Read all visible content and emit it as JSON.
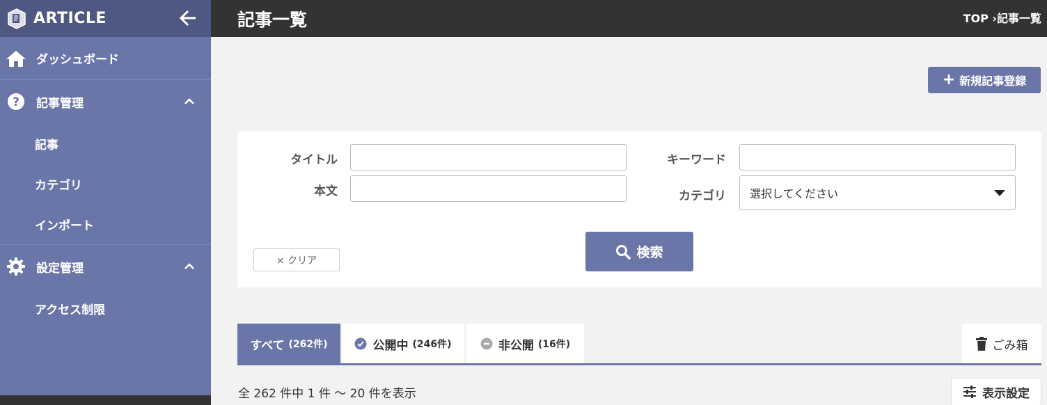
{
  "sidebar": {
    "app_title": "ARTICLE",
    "dashboard_label": "ダッシュボード",
    "article_mgmt_label": "記事管理",
    "article_items": [
      "記事",
      "カテゴリ",
      "インポート"
    ],
    "settings_label": "設定管理",
    "settings_items": [
      "アクセス制限"
    ]
  },
  "header": {
    "page_title": "記事一覧",
    "breadcrumb": "TOP ›記事一覧"
  },
  "actions": {
    "new_article": "新規記事登録"
  },
  "search": {
    "title_label": "タイトル",
    "title_value": "",
    "body_label": "本文",
    "body_value": "",
    "keyword_label": "キーワード",
    "keyword_value": "",
    "category_label": "カテゴリ",
    "category_selected": "選択してください",
    "clear_label": "× クリア",
    "search_label": "検索"
  },
  "tabs": [
    {
      "label": "すべて",
      "count": "(262件)",
      "active": true
    },
    {
      "label": "公開中",
      "count": "(246件)",
      "active": false
    },
    {
      "label": "非公開",
      "count": "(16件)",
      "active": false
    }
  ],
  "trash_label": "ごみ箱",
  "result_text": "全 262 件中 1 件 〜 20 件を表示",
  "display_settings_label": "表示設定",
  "colors": {
    "accent": "#6b76a8",
    "sidebar_header": "#4f5783",
    "topbar": "#333333",
    "published_icon": "#6b76a8",
    "unpublished_icon": "#aaaaaa"
  }
}
